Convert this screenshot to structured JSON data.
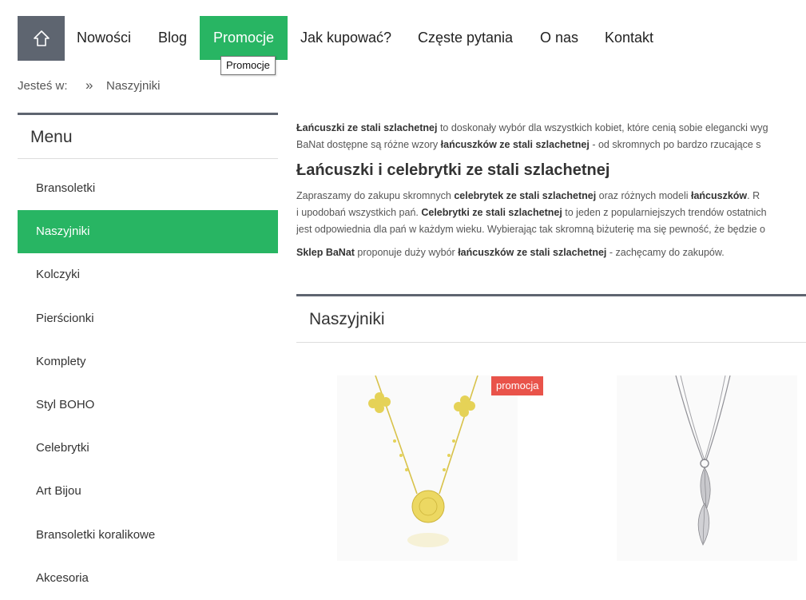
{
  "nav": {
    "home_icon": "home-icon",
    "items": [
      {
        "label": "Nowości"
      },
      {
        "label": "Blog"
      },
      {
        "label": "Promocje",
        "active": true
      },
      {
        "label": "Jak kupować?"
      },
      {
        "label": "Częste pytania"
      },
      {
        "label": "O nas"
      },
      {
        "label": "Kontakt"
      }
    ],
    "tooltip": "Promocje"
  },
  "breadcrumb": {
    "prefix": "Jesteś w:",
    "separator": "»",
    "current": "Naszyjniki"
  },
  "sidebar": {
    "title": "Menu",
    "items": [
      {
        "label": "Bransoletki"
      },
      {
        "label": "Naszyjniki",
        "active": true
      },
      {
        "label": "Kolczyki"
      },
      {
        "label": "Pierścionki"
      },
      {
        "label": "Komplety"
      },
      {
        "label": "Styl BOHO"
      },
      {
        "label": "Celebrytki"
      },
      {
        "label": "Art Bijou"
      },
      {
        "label": "Bransoletki koralikowe"
      },
      {
        "label": "Akcesoria"
      }
    ]
  },
  "content": {
    "p1_b1": "Łańcuszki ze stali szlachetnej",
    "p1_t1": " to doskonały wybór dla wszystkich kobiet, które cenią sobie elegancki wyg",
    "p1_t2": "BaNat dostępne są różne wzory ",
    "p1_b2": "łańcuszków ze stali szlachetnej",
    "p1_t3": " - od skromnych po bardzo rzucające s",
    "heading": "Łańcuszki i celebrytki ze stali szlachetnej",
    "p2_t1": "Zapraszamy do zakupu skromnych ",
    "p2_b1": "celebrytek ze stali szlachetnej",
    "p2_t2": " oraz różnych modeli ",
    "p2_b2": "łańcuszków",
    "p2_t3": ". R",
    "p2_t4": "i upodobań wszystkich pań. ",
    "p2_b3": "Celebrytki ze stali szlachetnej",
    "p2_t5": " to jeden z popularniejszych trendów ostatnich",
    "p2_t6": "jest odpowiednia dla pań w każdym wieku. Wybierając tak skromną biżuterię ma się pewność, że będzie o",
    "p3_b1": "Sklep BaNat",
    "p3_t1": " proponuje duży wybór ",
    "p3_b2": "łańcuszków ze stali szlachetnej",
    "p3_t2": " - zachęcamy do zakupów."
  },
  "section": {
    "title": "Naszyjniki"
  },
  "products": [
    {
      "badge": "promocja",
      "image": "gold-necklace-image"
    },
    {
      "image": "silver-feather-necklace-image"
    }
  ],
  "colors": {
    "accent": "#28b563",
    "dark": "#5e6570",
    "badge": "#e9534a"
  }
}
